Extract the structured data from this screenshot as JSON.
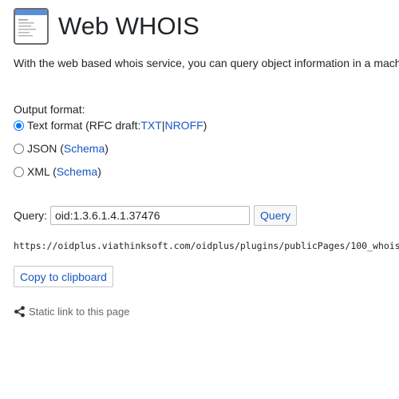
{
  "header": {
    "title": "Web WHOIS",
    "icon": "document-page-icon"
  },
  "intro": {
    "text": "With the web based whois service, you can query object information in a mach"
  },
  "output": {
    "label": "Output format:",
    "options": [
      {
        "id": "text",
        "checked": true,
        "prefix": "Text format (RFC draft: ",
        "links": [
          "TXT",
          "NROFF"
        ],
        "separator": " | ",
        "suffix": ")"
      },
      {
        "id": "json",
        "checked": false,
        "prefix": "JSON (",
        "link": "Schema",
        "suffix": ")"
      },
      {
        "id": "xml",
        "checked": false,
        "prefix": "XML (",
        "link": "Schema",
        "suffix": ")"
      }
    ]
  },
  "query": {
    "label": "Query:",
    "value": "oid:1.3.6.1.4.1.37476",
    "button": "Query"
  },
  "result_url": "https://oidplus.viathinksoft.com/oidplus/plugins/publicPages/100_whois/w",
  "copy_button": "Copy to clipboard",
  "static_link": {
    "icon": "share-icon",
    "text": "Static link to this page"
  },
  "colors": {
    "link": "#1a56c0",
    "radio_accent": "#0075ff",
    "muted_text": "#666666"
  }
}
